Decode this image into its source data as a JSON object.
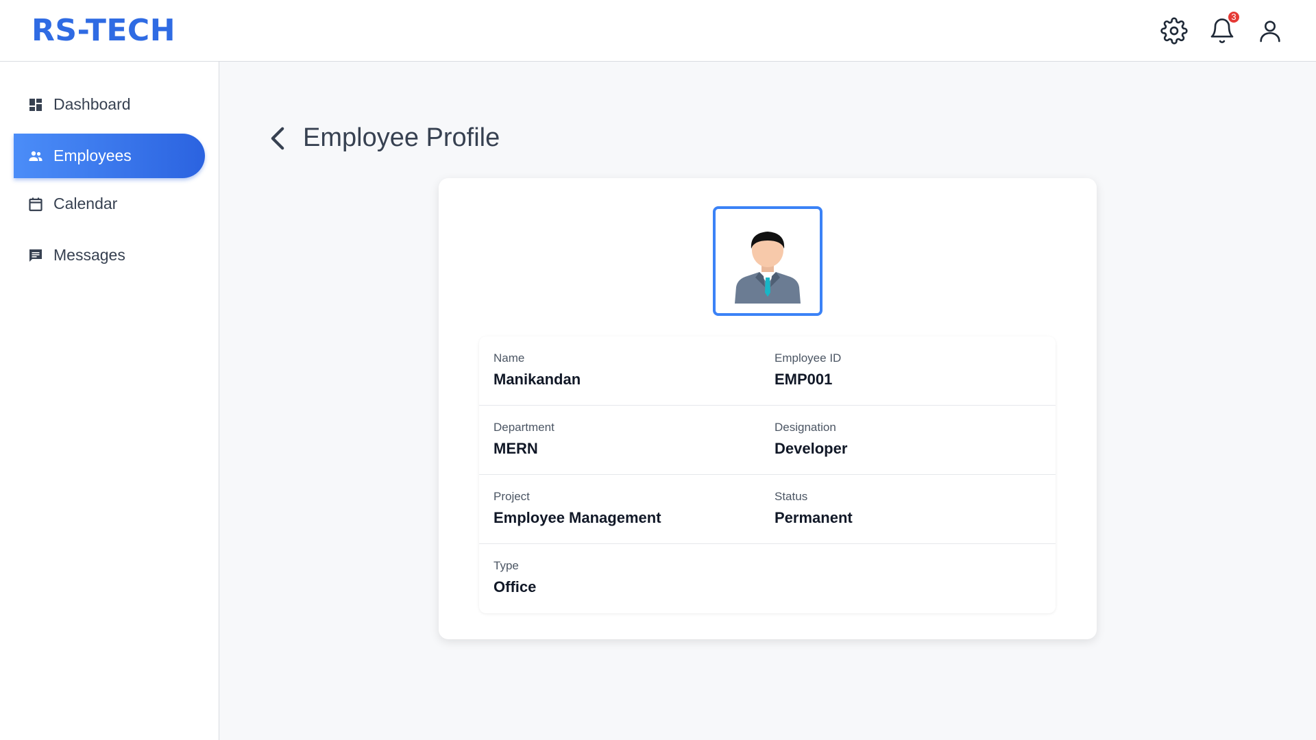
{
  "app": {
    "logo": "RS-TECH"
  },
  "header": {
    "icons": [
      "gear-icon",
      "bell-icon",
      "user-icon"
    ],
    "notification_count": "3"
  },
  "sidebar": {
    "items": [
      {
        "label": "Dashboard",
        "icon": "dashboard-icon",
        "active": false
      },
      {
        "label": "Employees",
        "icon": "people-icon",
        "active": true
      },
      {
        "label": "Calendar",
        "icon": "calendar-icon",
        "active": false
      },
      {
        "label": "Messages",
        "icon": "message-icon",
        "active": false
      }
    ]
  },
  "main": {
    "title": "Employee Profile",
    "profile": {
      "fields": [
        {
          "label": "Name",
          "value": "Manikandan"
        },
        {
          "label": "Employee ID",
          "value": "EMP001"
        },
        {
          "label": "Department",
          "value": "MERN"
        },
        {
          "label": "Designation",
          "value": "Developer"
        },
        {
          "label": "Project",
          "value": "Employee Management"
        },
        {
          "label": "Status",
          "value": "Permanent"
        },
        {
          "label": "Type",
          "value": "Office"
        }
      ]
    }
  },
  "colors": {
    "brand": "#2f6be3",
    "active_nav_start": "#4b8df8",
    "active_nav_end": "#2b63e0",
    "avatar_border": "#3b82f6",
    "badge": "#e53935"
  }
}
